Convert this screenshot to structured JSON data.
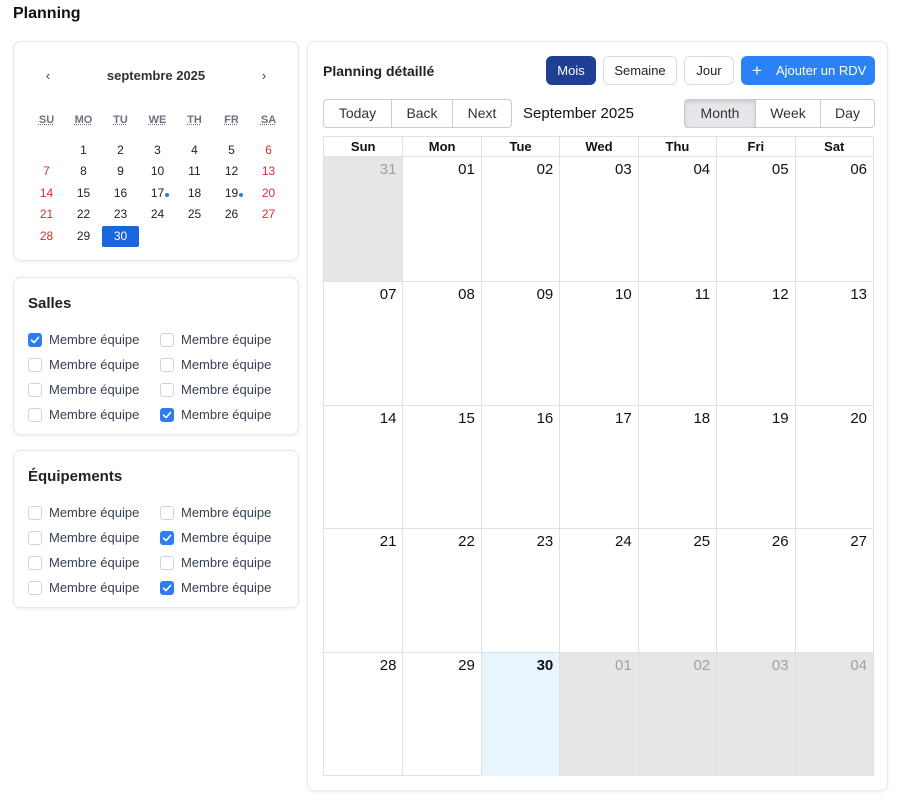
{
  "page_title": "Planning",
  "mini_calendar": {
    "month_label": "septembre 2025",
    "prev": "‹",
    "next": "›",
    "weekdays": [
      "SU",
      "MO",
      "TU",
      "WE",
      "TH",
      "FR",
      "SA"
    ],
    "start_offset": 1,
    "days": [
      {
        "d": "1"
      },
      {
        "d": "2"
      },
      {
        "d": "3"
      },
      {
        "d": "4"
      },
      {
        "d": "5"
      },
      {
        "d": "6",
        "weekend": true
      },
      {
        "d": "7",
        "weekend": true
      },
      {
        "d": "8"
      },
      {
        "d": "9"
      },
      {
        "d": "10"
      },
      {
        "d": "11"
      },
      {
        "d": "12"
      },
      {
        "d": "13",
        "weekend": true
      },
      {
        "d": "14",
        "weekend": true
      },
      {
        "d": "15"
      },
      {
        "d": "16"
      },
      {
        "d": "17",
        "event": true
      },
      {
        "d": "18"
      },
      {
        "d": "19",
        "event": true
      },
      {
        "d": "20",
        "weekend": true
      },
      {
        "d": "21",
        "weekend": true
      },
      {
        "d": "22"
      },
      {
        "d": "23"
      },
      {
        "d": "24"
      },
      {
        "d": "25"
      },
      {
        "d": "26"
      },
      {
        "d": "27",
        "weekend": true
      },
      {
        "d": "28",
        "weekend": true
      },
      {
        "d": "29"
      },
      {
        "d": "30",
        "selected": true
      }
    ]
  },
  "salles": {
    "title": "Salles",
    "items": [
      {
        "label": "Membre équipe",
        "checked": true
      },
      {
        "label": "Membre équipe",
        "checked": false
      },
      {
        "label": "Membre équipe",
        "checked": false
      },
      {
        "label": "Membre équipe",
        "checked": false
      },
      {
        "label": "Membre équipe",
        "checked": false
      },
      {
        "label": "Membre équipe",
        "checked": false
      },
      {
        "label": "Membre équipe",
        "checked": false
      },
      {
        "label": "Membre équipe",
        "checked": true
      }
    ]
  },
  "equipements": {
    "title": "Équipements",
    "items": [
      {
        "label": "Membre équipe",
        "checked": false
      },
      {
        "label": "Membre équipe",
        "checked": false
      },
      {
        "label": "Membre équipe",
        "checked": false
      },
      {
        "label": "Membre équipe",
        "checked": true
      },
      {
        "label": "Membre équipe",
        "checked": false
      },
      {
        "label": "Membre équipe",
        "checked": false
      },
      {
        "label": "Membre équipe",
        "checked": false
      },
      {
        "label": "Membre équipe",
        "checked": true
      }
    ]
  },
  "planning": {
    "title": "Planning détaillé",
    "view_buttons": {
      "mois": "Mois",
      "semaine": "Semaine",
      "jour": "Jour"
    },
    "active_view": "mois",
    "add_button": {
      "icon": "plus-icon",
      "label": "Ajouter un RDV"
    },
    "toolbar": {
      "today": "Today",
      "back": "Back",
      "next": "Next",
      "label": "September 2025",
      "month": "Month",
      "week": "Week",
      "day": "Day",
      "active": "month"
    },
    "weekday_headers": [
      "Sun",
      "Mon",
      "Tue",
      "Wed",
      "Thu",
      "Fri",
      "Sat"
    ],
    "cells": [
      {
        "d": "31",
        "off": true
      },
      {
        "d": "01"
      },
      {
        "d": "02"
      },
      {
        "d": "03"
      },
      {
        "d": "04"
      },
      {
        "d": "05"
      },
      {
        "d": "06"
      },
      {
        "d": "07"
      },
      {
        "d": "08"
      },
      {
        "d": "09"
      },
      {
        "d": "10"
      },
      {
        "d": "11"
      },
      {
        "d": "12"
      },
      {
        "d": "13"
      },
      {
        "d": "14"
      },
      {
        "d": "15"
      },
      {
        "d": "16"
      },
      {
        "d": "17"
      },
      {
        "d": "18"
      },
      {
        "d": "19"
      },
      {
        "d": "20"
      },
      {
        "d": "21"
      },
      {
        "d": "22"
      },
      {
        "d": "23"
      },
      {
        "d": "24"
      },
      {
        "d": "25"
      },
      {
        "d": "26"
      },
      {
        "d": "27"
      },
      {
        "d": "28"
      },
      {
        "d": "29"
      },
      {
        "d": "30",
        "today": true
      },
      {
        "d": "01",
        "off": true
      },
      {
        "d": "02",
        "off": true
      },
      {
        "d": "03",
        "off": true
      },
      {
        "d": "04",
        "off": true
      }
    ]
  },
  "colors": {
    "primary_dark": "#1f3f94",
    "primary": "#2b82f6",
    "selected_day": "#1a66e0",
    "weekend_red": "#d32f2f",
    "today_bg": "#e8f4fe",
    "off_bg": "#e6e6e6"
  }
}
